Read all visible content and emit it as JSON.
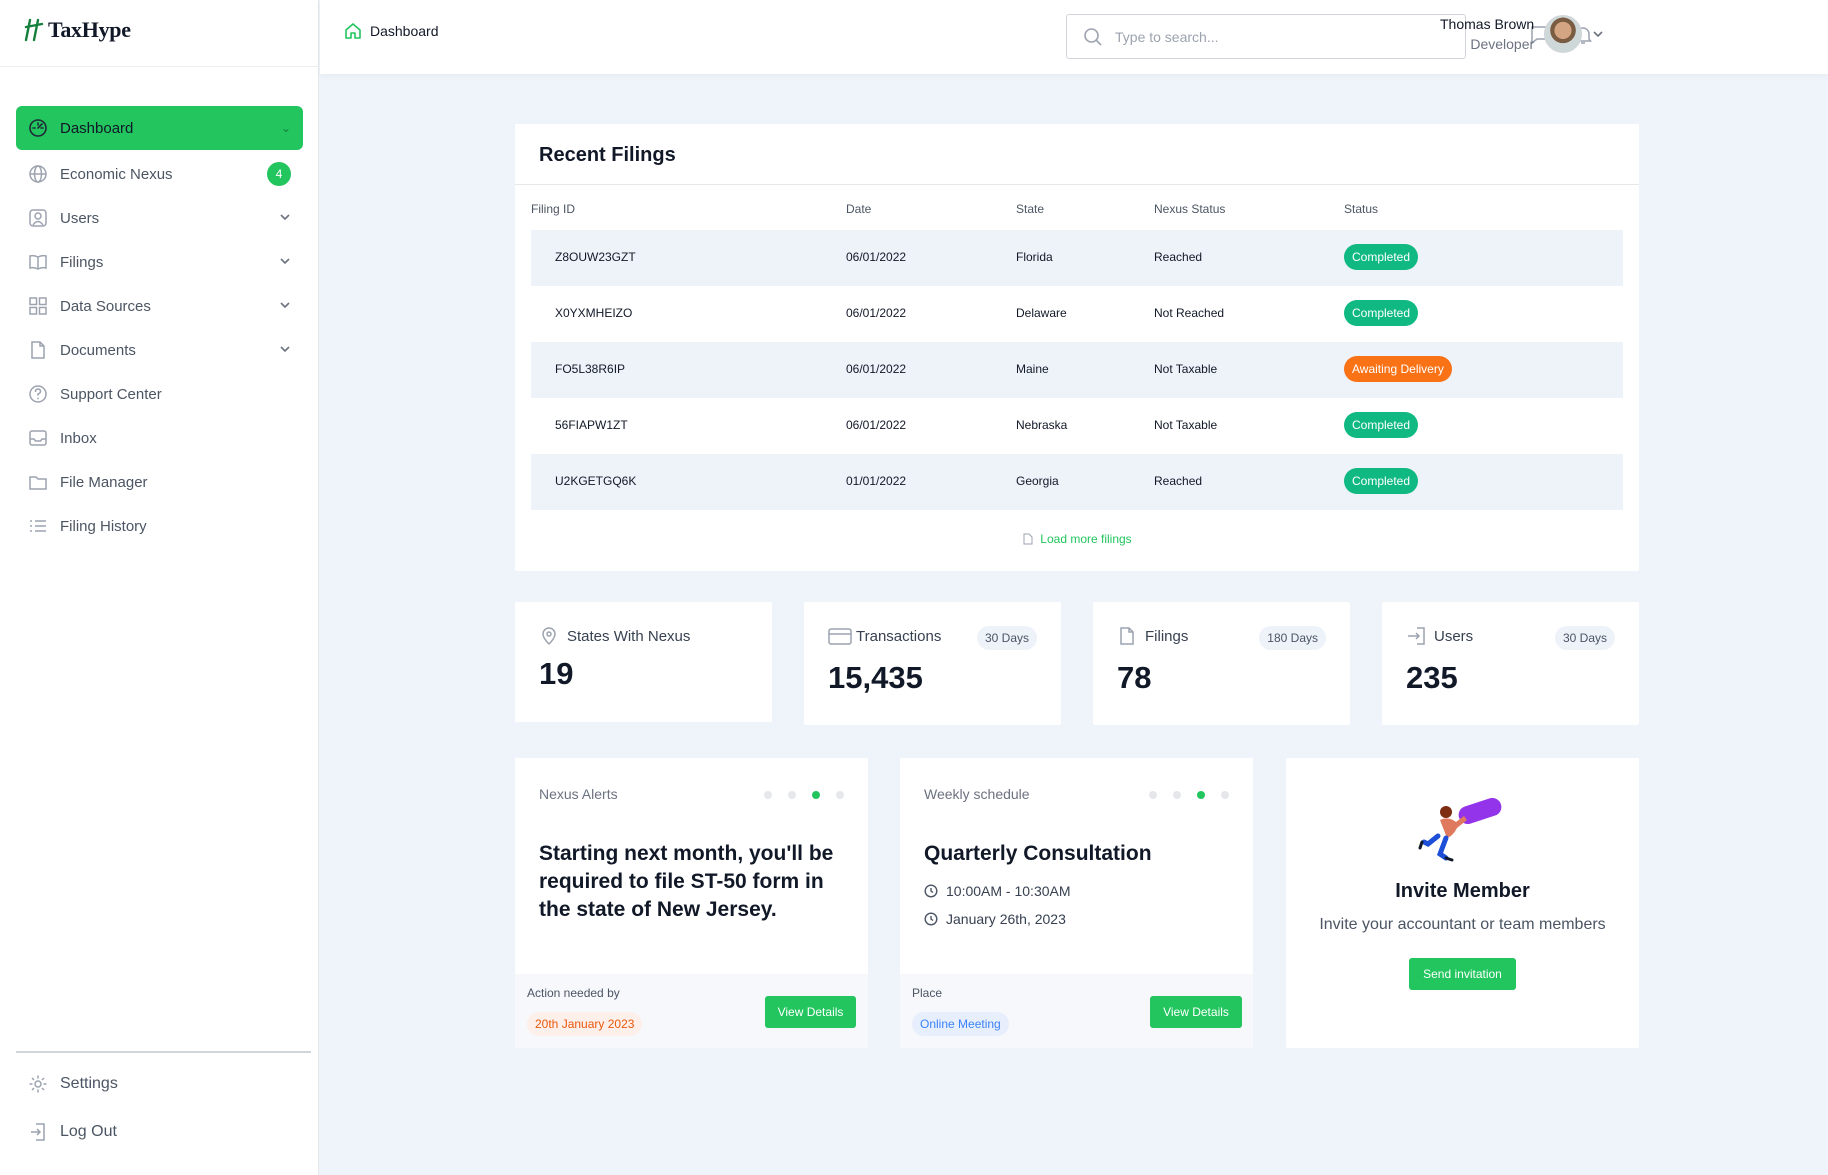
{
  "app": {
    "name": "TaxHype"
  },
  "sidebar": {
    "items": [
      {
        "label": "Dashboard",
        "icon": "dashboard-icon"
      },
      {
        "label": "Economic Nexus",
        "icon": "globe-icon",
        "badge": "4"
      },
      {
        "label": "Users",
        "icon": "user-icon"
      },
      {
        "label": "Filings",
        "icon": "book-icon"
      },
      {
        "label": "Data Sources",
        "icon": "grid-icon"
      },
      {
        "label": "Documents",
        "icon": "document-icon"
      },
      {
        "label": "Support Center",
        "icon": "help-icon"
      },
      {
        "label": "Inbox",
        "icon": "inbox-icon"
      },
      {
        "label": "File Manager",
        "icon": "folder-icon"
      },
      {
        "label": "Filing History",
        "icon": "list-icon"
      }
    ],
    "bottom": [
      {
        "label": "Settings",
        "icon": "gear-icon"
      },
      {
        "label": "Log Out",
        "icon": "logout-icon"
      }
    ]
  },
  "header": {
    "breadcrumb": "Dashboard",
    "search_placeholder": "Type to search...",
    "user_name": "Thomas Brown",
    "user_role": "Developer"
  },
  "recent_filings": {
    "title": "Recent Filings",
    "columns": [
      "Filing ID",
      "Date",
      "State",
      "Nexus Status",
      "Status"
    ],
    "rows": [
      {
        "id": "Z8OUW23GZT",
        "date": "06/01/2022",
        "state": "Florida",
        "nexus": "Reached",
        "status": "Completed"
      },
      {
        "id": "X0YXMHEIZO",
        "date": "06/01/2022",
        "state": "Delaware",
        "nexus": "Not Reached",
        "status": "Completed"
      },
      {
        "id": "FO5L38R6IP",
        "date": "06/01/2022",
        "state": "Maine",
        "nexus": "Not Taxable",
        "status": "Awaiting Delivery"
      },
      {
        "id": "56FIAPW1ZT",
        "date": "06/01/2022",
        "state": "Nebraska",
        "nexus": "Not Taxable",
        "status": "Completed"
      },
      {
        "id": "U2KGETGQ6K",
        "date": "01/01/2022",
        "state": "Georgia",
        "nexus": "Reached",
        "status": "Completed"
      }
    ],
    "load_more": "Load more filings"
  },
  "stats": [
    {
      "label": "States With Nexus",
      "value": "19",
      "chip": ""
    },
    {
      "label": "Transactions",
      "value": "15,435",
      "chip": "30 Days"
    },
    {
      "label": "Filings",
      "value": "78",
      "chip": "180 Days"
    },
    {
      "label": "Users",
      "value": "235",
      "chip": "30 Days"
    }
  ],
  "nexus_alerts": {
    "title": "Nexus Alerts",
    "message": "Starting next month, you'll be required to file ST-50 form in the state of New Jersey.",
    "footer_label": "Action needed by",
    "footer_value": "20th January 2023",
    "button": "View Details"
  },
  "weekly_schedule": {
    "title": "Weekly schedule",
    "event": "Quarterly Consultation",
    "time": "10:00AM - 10:30AM",
    "date": "January 26th, 2023",
    "footer_label": "Place",
    "footer_value": "Online Meeting",
    "button": "View Details"
  },
  "invite": {
    "title": "Invite Member",
    "subtitle": "Invite your accountant or team members",
    "button": "Send invitation"
  },
  "colors": {
    "accent": "#22c55e",
    "completed": "#10b981",
    "awaiting": "#f97316",
    "background": "#eff3fa"
  }
}
